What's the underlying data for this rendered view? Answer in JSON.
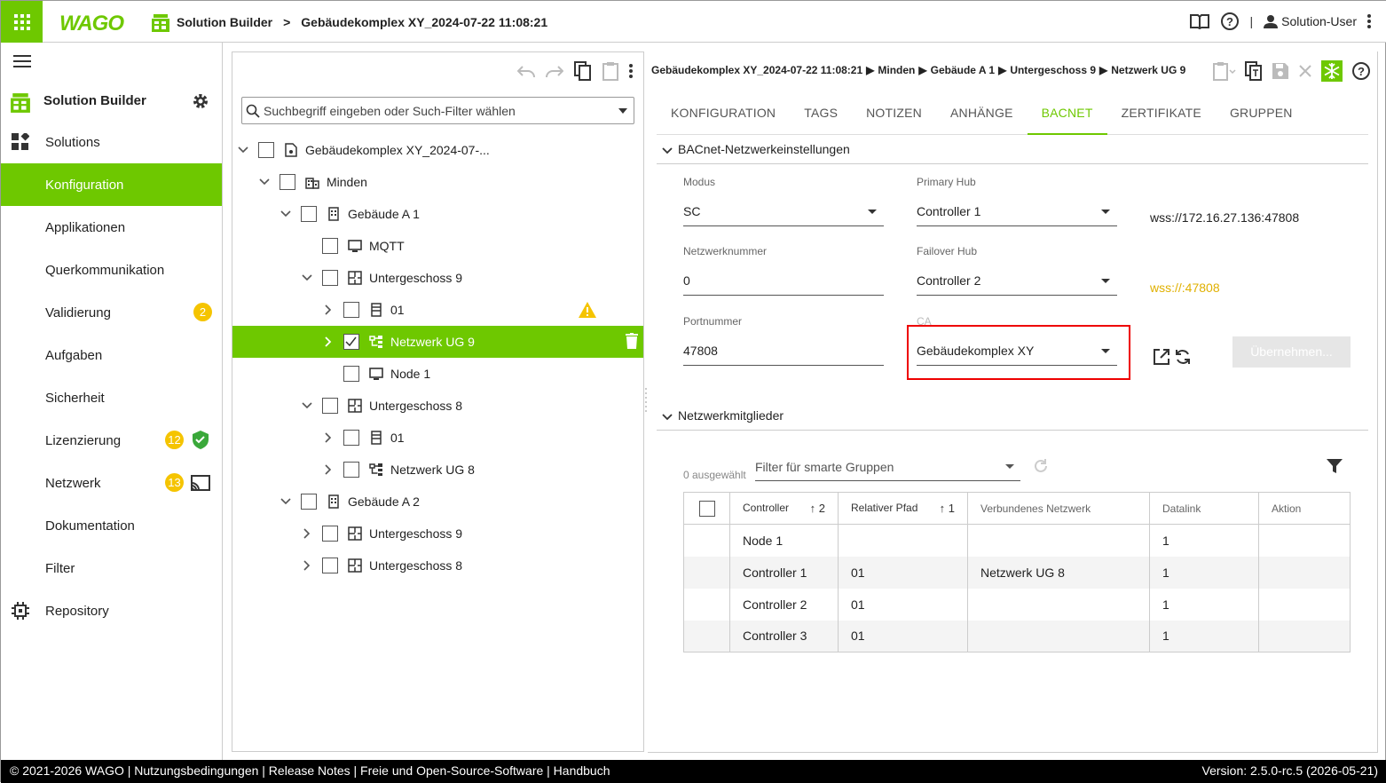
{
  "header": {
    "logo_text": "WAGO",
    "breadcrumb_app": "Solution Builder",
    "breadcrumb_project": "Gebäudekomplex XY_2024-07-22 11:08:21",
    "user": "Solution-User"
  },
  "sidebar": {
    "title": "Solution Builder",
    "items": [
      {
        "label": "Solutions"
      },
      {
        "label": "Konfiguration"
      },
      {
        "label": "Applikationen"
      },
      {
        "label": "Querkommunikation"
      },
      {
        "label": "Validierung",
        "badge": "2"
      },
      {
        "label": "Aufgaben"
      },
      {
        "label": "Sicherheit"
      },
      {
        "label": "Lizenzierung",
        "badge": "12"
      },
      {
        "label": "Netzwerk",
        "badge": "13"
      },
      {
        "label": "Dokumentation"
      },
      {
        "label": "Filter"
      },
      {
        "label": "Repository"
      }
    ]
  },
  "tree": {
    "search_placeholder": "Suchbegriff eingeben oder Such-Filter wählen",
    "nodes": [
      {
        "label": "Gebäudekomplex XY_2024-07-..."
      },
      {
        "label": "Minden"
      },
      {
        "label": "Gebäude A 1"
      },
      {
        "label": "MQTT"
      },
      {
        "label": "Untergeschoss 9"
      },
      {
        "label": "01"
      },
      {
        "label": "Netzwerk UG 9"
      },
      {
        "label": "Node 1"
      },
      {
        "label": "Untergeschoss 8"
      },
      {
        "label": "01"
      },
      {
        "label": "Netzwerk UG 8"
      },
      {
        "label": "Gebäude A 2"
      },
      {
        "label": "Untergeschoss 9"
      },
      {
        "label": "Untergeschoss 8"
      }
    ]
  },
  "detail": {
    "breadcrumb": [
      "Gebäudekomplex XY_2024-07-22 11:08:21",
      "Minden",
      "Gebäude A 1",
      "Untergeschoss 9",
      "Netzwerk UG 9"
    ],
    "tabs": [
      "KONFIGURATION",
      "TAGS",
      "NOTIZEN",
      "ANHÄNGE",
      "BACNET",
      "ZERTIFIKATE",
      "GRUPPEN"
    ],
    "section_settings": "BACnet-Netzwerkeinstellungen",
    "modus_label": "Modus",
    "modus_value": "SC",
    "primary_hub_label": "Primary Hub",
    "primary_hub_value": "Controller 1",
    "primary_url": "wss://172.16.27.136:47808",
    "netzwerknummer_label": "Netzwerknummer",
    "netzwerknummer_value": "0",
    "failover_hub_label": "Failover Hub",
    "failover_hub_value": "Controller 2",
    "failover_url": "wss://:47808",
    "portnummer_label": "Portnummer",
    "portnummer_value": "47808",
    "ca_label": "CA",
    "ca_value": "Gebäudekomplex XY",
    "apply_button": "Übernehmen...",
    "section_members": "Netzwerkmitglieder",
    "selected_count": "0 ausgewählt",
    "group_filter_placeholder": "Filter für smarte Gruppen",
    "columns": [
      "Controller",
      "Relativer Pfad",
      "Verbundenes Netzwerk",
      "Datalink",
      "Aktion"
    ],
    "sort_controller": "2",
    "sort_path": "1",
    "rows": [
      {
        "controller": "Node 1",
        "path": "",
        "network": "",
        "datalink": "1"
      },
      {
        "controller": "Controller 1",
        "path": "01",
        "network": "Netzwerk UG 8",
        "datalink": "1"
      },
      {
        "controller": "Controller 2",
        "path": "01",
        "network": "",
        "datalink": "1"
      },
      {
        "controller": "Controller 3",
        "path": "01",
        "network": "",
        "datalink": "1"
      }
    ]
  },
  "footer": {
    "left": "© 2021-2026 WAGO | Nutzungsbedingungen | Release Notes | Freie und Open-Source-Software | Handbuch",
    "right": "Version: 2.5.0-rc.5 (2026-05-21)"
  },
  "colors": {
    "accent": "#6ec800",
    "warning": "#f5c400",
    "url_warn": "#e0b000",
    "highlight_box": "#e00000"
  }
}
